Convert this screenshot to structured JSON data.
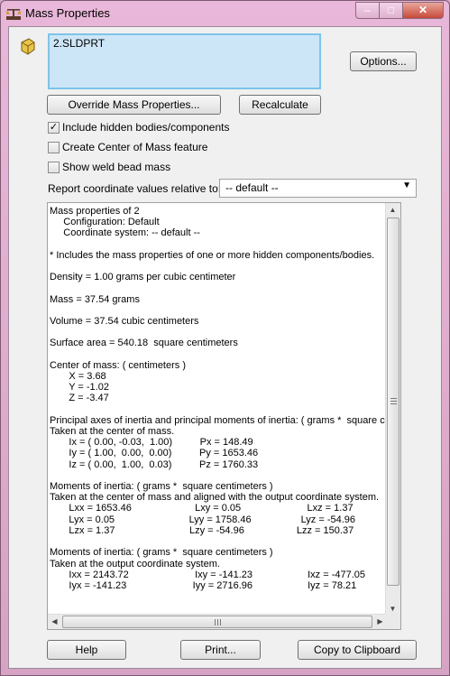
{
  "window": {
    "title": "Mass Properties",
    "close_glyph": "✕",
    "maximize_glyph": "□",
    "minimize_glyph": "–"
  },
  "selection": {
    "items": [
      "2.SLDPRT"
    ]
  },
  "buttons": {
    "options": "Options...",
    "override": "Override Mass Properties...",
    "recalculate": "Recalculate",
    "help": "Help",
    "print": "Print...",
    "copy": "Copy to Clipboard"
  },
  "options": {
    "include_hidden": {
      "label": "Include hidden bodies/components",
      "checked": true
    },
    "create_com": {
      "label": "Create Center of Mass feature",
      "checked": false
    },
    "weld_bead": {
      "label": "Show weld bead mass",
      "checked": false
    }
  },
  "report": {
    "label": "Report coordinate values relative to:",
    "selected": "-- default --"
  },
  "results": {
    "lines": [
      "Mass properties of 2",
      "     Configuration: Default",
      "     Coordinate system: -- default --",
      "",
      "* Includes the mass properties of one or more hidden components/bodies.",
      "",
      "Density = 1.00 grams per cubic centimeter",
      "",
      "Mass = 37.54 grams",
      "",
      "Volume = 37.54 cubic centimeters",
      "",
      "Surface area = 540.18  square centimeters",
      "",
      "Center of mass: ( centimeters )",
      "       X = 3.68",
      "       Y = -1.02",
      "       Z = -3.47",
      "",
      "Principal axes of inertia and principal moments of inertia: ( grams *  square centimeters )",
      "Taken at the center of mass.",
      "       Ix = ( 0.00, -0.03,  1.00)          Px = 148.49",
      "       Iy = ( 1.00,  0.00,  0.00)          Py = 1653.46",
      "       Iz = ( 0.00,  1.00,  0.03)          Pz = 1760.33",
      "",
      "Moments of inertia: ( grams *  square centimeters )",
      "Taken at the center of mass and aligned with the output coordinate system.",
      "       Lxx = 1653.46                       Lxy = 0.05                        Lxz = 1.37",
      "       Lyx = 0.05                           Lyy = 1758.46                  Lyz = -54.96",
      "       Lzx = 1.37                           Lzy = -54.96                   Lzz = 150.37",
      "",
      "Moments of inertia: ( grams *  square centimeters )",
      "Taken at the output coordinate system.",
      "       Ixx = 2143.72                        Ixy = -141.23                    Ixz = -477.05",
      "       Iyx = -141.23                        Iyy = 2716.96                    Iyz = 78.21"
    ]
  }
}
